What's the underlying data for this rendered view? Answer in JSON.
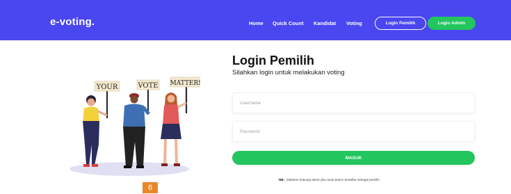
{
  "navbar": {
    "brand": "e-voting.",
    "links": [
      "Home",
      "Quick Count",
      "Kandidat",
      "Voting"
    ],
    "login_pemilih": "Login Pemilih",
    "login_admin": "Login Admin"
  },
  "illustration": {
    "signs": [
      "YOUR",
      "VOTE",
      "MATTERS"
    ]
  },
  "form": {
    "title": "Login Pemilih",
    "subtitle": "Silahkan login untuk melakukan voting",
    "username_placeholder": "Username",
    "password_placeholder": "Password",
    "submit_label": "MASUK",
    "note_prefix": "NB :",
    "note_text": " Silahkan hubungi admin jika anda belum terdaftar sebagai pemilih"
  },
  "page_badge": "6",
  "colors": {
    "navbar": "#4a46f0",
    "accent_green": "#22c55e",
    "badge": "#e8872a"
  }
}
